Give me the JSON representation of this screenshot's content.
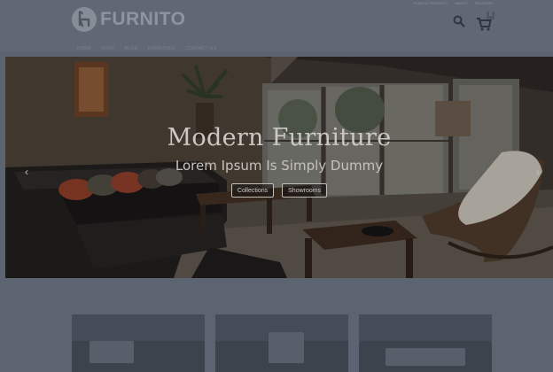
{
  "header": {
    "logo_text": "FURNITO",
    "top_links": [
      "PUBLIC PRODUCT",
      "ABOUT",
      "REVIEWS"
    ],
    "cart_count": "0",
    "nav": [
      "HOME",
      "SHOP",
      "BLOG",
      "FURNITURE",
      "CONTACT US"
    ]
  },
  "hero": {
    "title": "Modern Furniture",
    "subtitle": "Lorem Ipsum Is Simply Dummy",
    "buttons": [
      "Collections",
      "Showrooms"
    ]
  },
  "colors": {
    "overlay": "#5b6470",
    "hero_text": "#f3efe9"
  }
}
